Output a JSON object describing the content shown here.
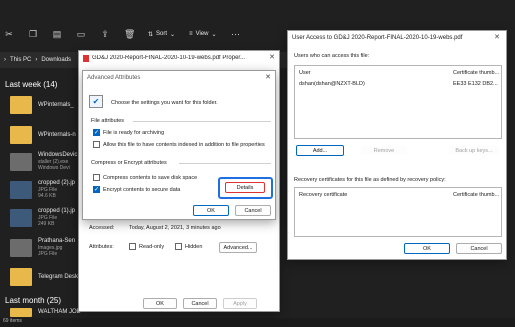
{
  "explorer": {
    "toolbar": {
      "sort_label": "Sort",
      "view_label": "View"
    },
    "address": {
      "this_pc": "This PC",
      "downloads": "Downloads"
    },
    "groups": {
      "last_week": "Last week (14)",
      "last_month": "Last month (25)"
    },
    "files": [
      {
        "name": "WPinternals_",
        "sub": "",
        "kind": "folder"
      },
      {
        "name": "WPinternals-n",
        "sub": "",
        "kind": "folder"
      },
      {
        "name": "WindowsDevic",
        "sub2": "staller (2).exe",
        "sub": "Windows Devi",
        "kind": "dark"
      },
      {
        "name": "WindowsDevic",
        "sub2": "staller.exe",
        "sub": "",
        "kind": "dark"
      },
      {
        "name": "cropped (2).jp",
        "sub": "JPG File",
        "sub2": "94.6 KB",
        "kind": "vid"
      },
      {
        "name": "cropped (1).jp",
        "sub": "JPG File",
        "sub2": "249 KB",
        "kind": "vid"
      },
      {
        "name": "Prathana-Sen",
        "sub": "Images.jpg",
        "sub2": "JPG File",
        "kind": "dark"
      },
      {
        "name": "Telegram Desk",
        "sub": "",
        "kind": "folder"
      },
      {
        "name": "WALTHAM JOB",
        "sub": "",
        "kind": "folder"
      }
    ],
    "status_left": "69 items"
  },
  "props": {
    "title": "GD&J 2020-Report-FINAL-2020-10-19-webs.pdf Proper...",
    "accessed_label": "Accessed:",
    "accessed_value": "Today, August 2, 2021, 3 minutes ago",
    "attributes_label": "Attributes:",
    "readonly_label": "Read-only",
    "hidden_label": "Hidden",
    "advanced_btn": "Advanced...",
    "ok": "OK",
    "cancel": "Cancel",
    "apply": "Apply"
  },
  "adv": {
    "title": "Advanced Attributes",
    "intro": "Choose the settings you want for this folder.",
    "file_attrs_header": "File attributes",
    "archive_label": "File is ready for archiving",
    "index_label": "Allow this file to have contents indexed in addition to file properties",
    "compress_header": "Compress or Encrypt attributes",
    "compress_label": "Compress contents to save disk space",
    "encrypt_label": "Encrypt contents to secure data",
    "details_btn": "Details",
    "ok": "OK",
    "cancel": "Cancel"
  },
  "access": {
    "title": "User Access to GD&J 2020-Report-FINAL-2020-10-19-webs.pdf",
    "users_label": "Users who can access this file:",
    "col_user": "User",
    "col_cert": "Certificate thumb...",
    "user_name": "dshan(dshan@NZXT-BLD)",
    "user_cert": "EE33 E132 DB2...",
    "add_btn": "Add...",
    "remove_btn": "Remove",
    "backup_btn": "Back up keys...",
    "recovery_label": "Recovery certificates for this file as defined by recovery policy:",
    "col_recovery": "Recovery certificate",
    "col_recovery_cert": "Certificate thumb...",
    "ok": "OK",
    "cancel": "Cancel"
  }
}
